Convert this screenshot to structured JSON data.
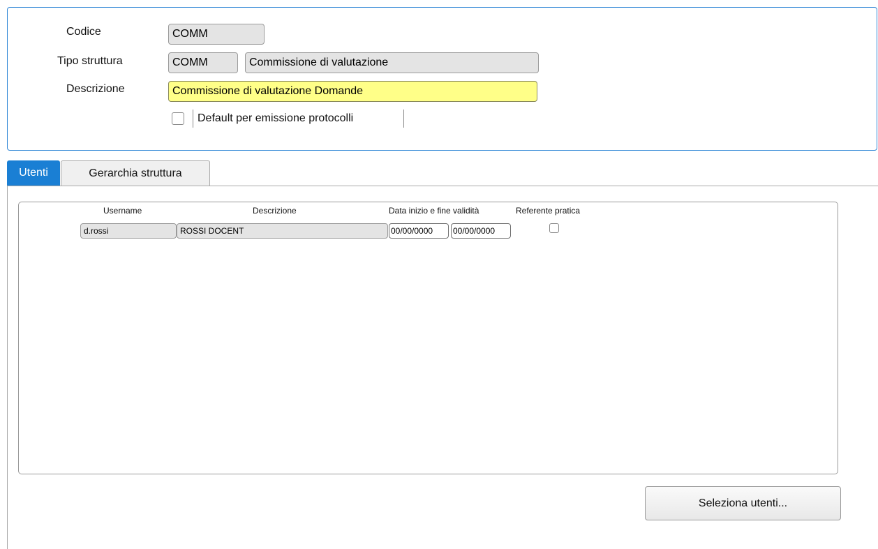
{
  "header": {
    "codice_label": "Codice",
    "codice_value": "COMM",
    "tipo_label": "Tipo struttura",
    "tipo_code": "COMM",
    "tipo_desc": "Commissione di valutazione",
    "descrizione_label": "Descrizione",
    "descrizione_value": "Commissione di valutazione Domande",
    "default_label": "Default per emissione protocolli",
    "default_checked": false
  },
  "tabs": [
    {
      "label": "Utenti",
      "active": true
    },
    {
      "label": "Gerarchia struttura",
      "active": false
    }
  ],
  "users_table": {
    "columns": [
      "Username",
      "Descrizione",
      "Data inizio e fine validità",
      "Referente pratica"
    ],
    "rows": [
      {
        "username": "d.rossi",
        "descrizione": "ROSSI DOCENT",
        "data_inizio": "00/00/0000",
        "data_fine": "00/00/0000",
        "referente": false
      }
    ]
  },
  "actions": {
    "select_users_label": "Seleziona utenti..."
  },
  "colors": {
    "accent": "#1a7fd4",
    "highlight_field": "#ffff88",
    "readonly_field": "#e4e4e4"
  }
}
